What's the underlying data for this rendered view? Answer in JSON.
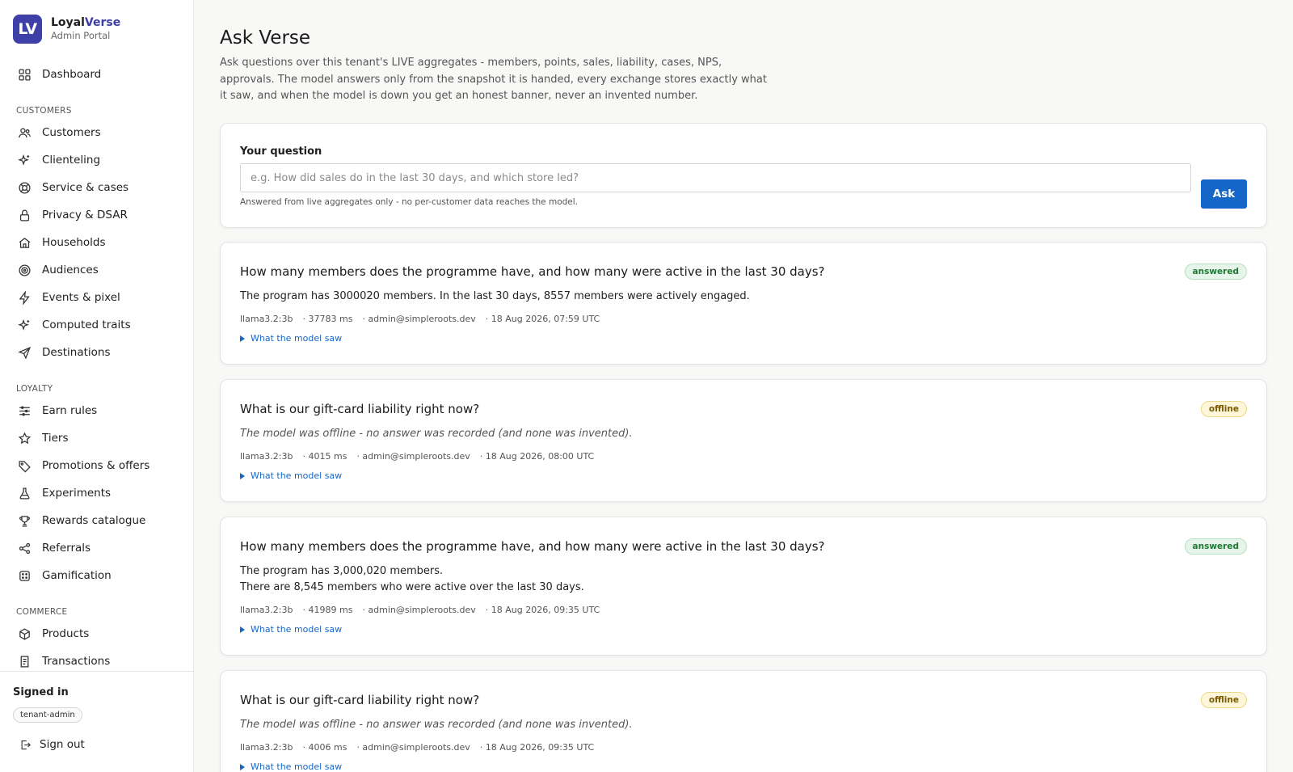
{
  "brand": {
    "logo_text": "LV",
    "name_part1": "Loyal",
    "name_part2": "Verse",
    "subtitle": "Admin Portal",
    "accent_color": "#3f3fa8"
  },
  "nav": {
    "dashboard": "Dashboard",
    "sections": [
      {
        "title": "CUSTOMERS",
        "items": [
          "Customers",
          "Clienteling",
          "Service & cases",
          "Privacy & DSAR",
          "Households",
          "Audiences",
          "Events & pixel",
          "Computed traits",
          "Destinations"
        ]
      },
      {
        "title": "LOYALTY",
        "items": [
          "Earn rules",
          "Tiers",
          "Promotions & offers",
          "Experiments",
          "Rewards catalogue",
          "Referrals",
          "Gamification"
        ]
      },
      {
        "title": "COMMERCE",
        "items": [
          "Products",
          "Transactions"
        ]
      }
    ]
  },
  "account": {
    "signed_label": "Signed in",
    "role": "tenant-admin",
    "signout": "Sign out"
  },
  "page": {
    "title": "Ask Verse",
    "description": "Ask questions over this tenant's LIVE aggregates - members, points, sales, liability, cases, NPS, approvals. The model answers only from the snapshot it is handed, every exchange stores exactly what it saw, and when the model is down you get an honest banner, never an invented number."
  },
  "ask": {
    "label": "Your question",
    "placeholder": "e.g. How did sales do in the last 30 days, and which store led?",
    "value": "",
    "help": "Answered from live aggregates only - no per-customer data reaches the model.",
    "button": "Ask",
    "button_color": "#1666c9"
  },
  "entries": [
    {
      "question": "How many members does the programme have, and how many were active in the last 30 days?",
      "status": "answered",
      "answer": [
        "The program has 3000020 members. In the last 30 days, 8557 members were actively engaged."
      ],
      "offline": false,
      "model": "llama3.2:3b",
      "duration": "· 37783 ms",
      "user": "· admin@simpleroots.dev",
      "time": "· 18 Aug 2026, 07:59 UTC",
      "saw": "What the model saw"
    },
    {
      "question": "What is our gift-card liability right now?",
      "status": "offline",
      "answer": [
        "The model was offline - no answer was recorded (and none was invented)."
      ],
      "offline": true,
      "model": "llama3.2:3b",
      "duration": "· 4015 ms",
      "user": "· admin@simpleroots.dev",
      "time": "· 18 Aug 2026, 08:00 UTC",
      "saw": "What the model saw"
    },
    {
      "question": "How many members does the programme have, and how many were active in the last 30 days?",
      "status": "answered",
      "answer": [
        "The program has 3,000,020 members.",
        "There are 8,545 members who were active over the last 30 days."
      ],
      "offline": false,
      "model": "llama3.2:3b",
      "duration": "· 41989 ms",
      "user": "· admin@simpleroots.dev",
      "time": "· 18 Aug 2026, 09:35 UTC",
      "saw": "What the model saw"
    },
    {
      "question": "What is our gift-card liability right now?",
      "status": "offline",
      "answer": [
        "The model was offline - no answer was recorded (and none was invented)."
      ],
      "offline": true,
      "model": "llama3.2:3b",
      "duration": "· 4006 ms",
      "user": "· admin@simpleroots.dev",
      "time": "· 18 Aug 2026, 09:35 UTC",
      "saw": "What the model saw"
    }
  ]
}
